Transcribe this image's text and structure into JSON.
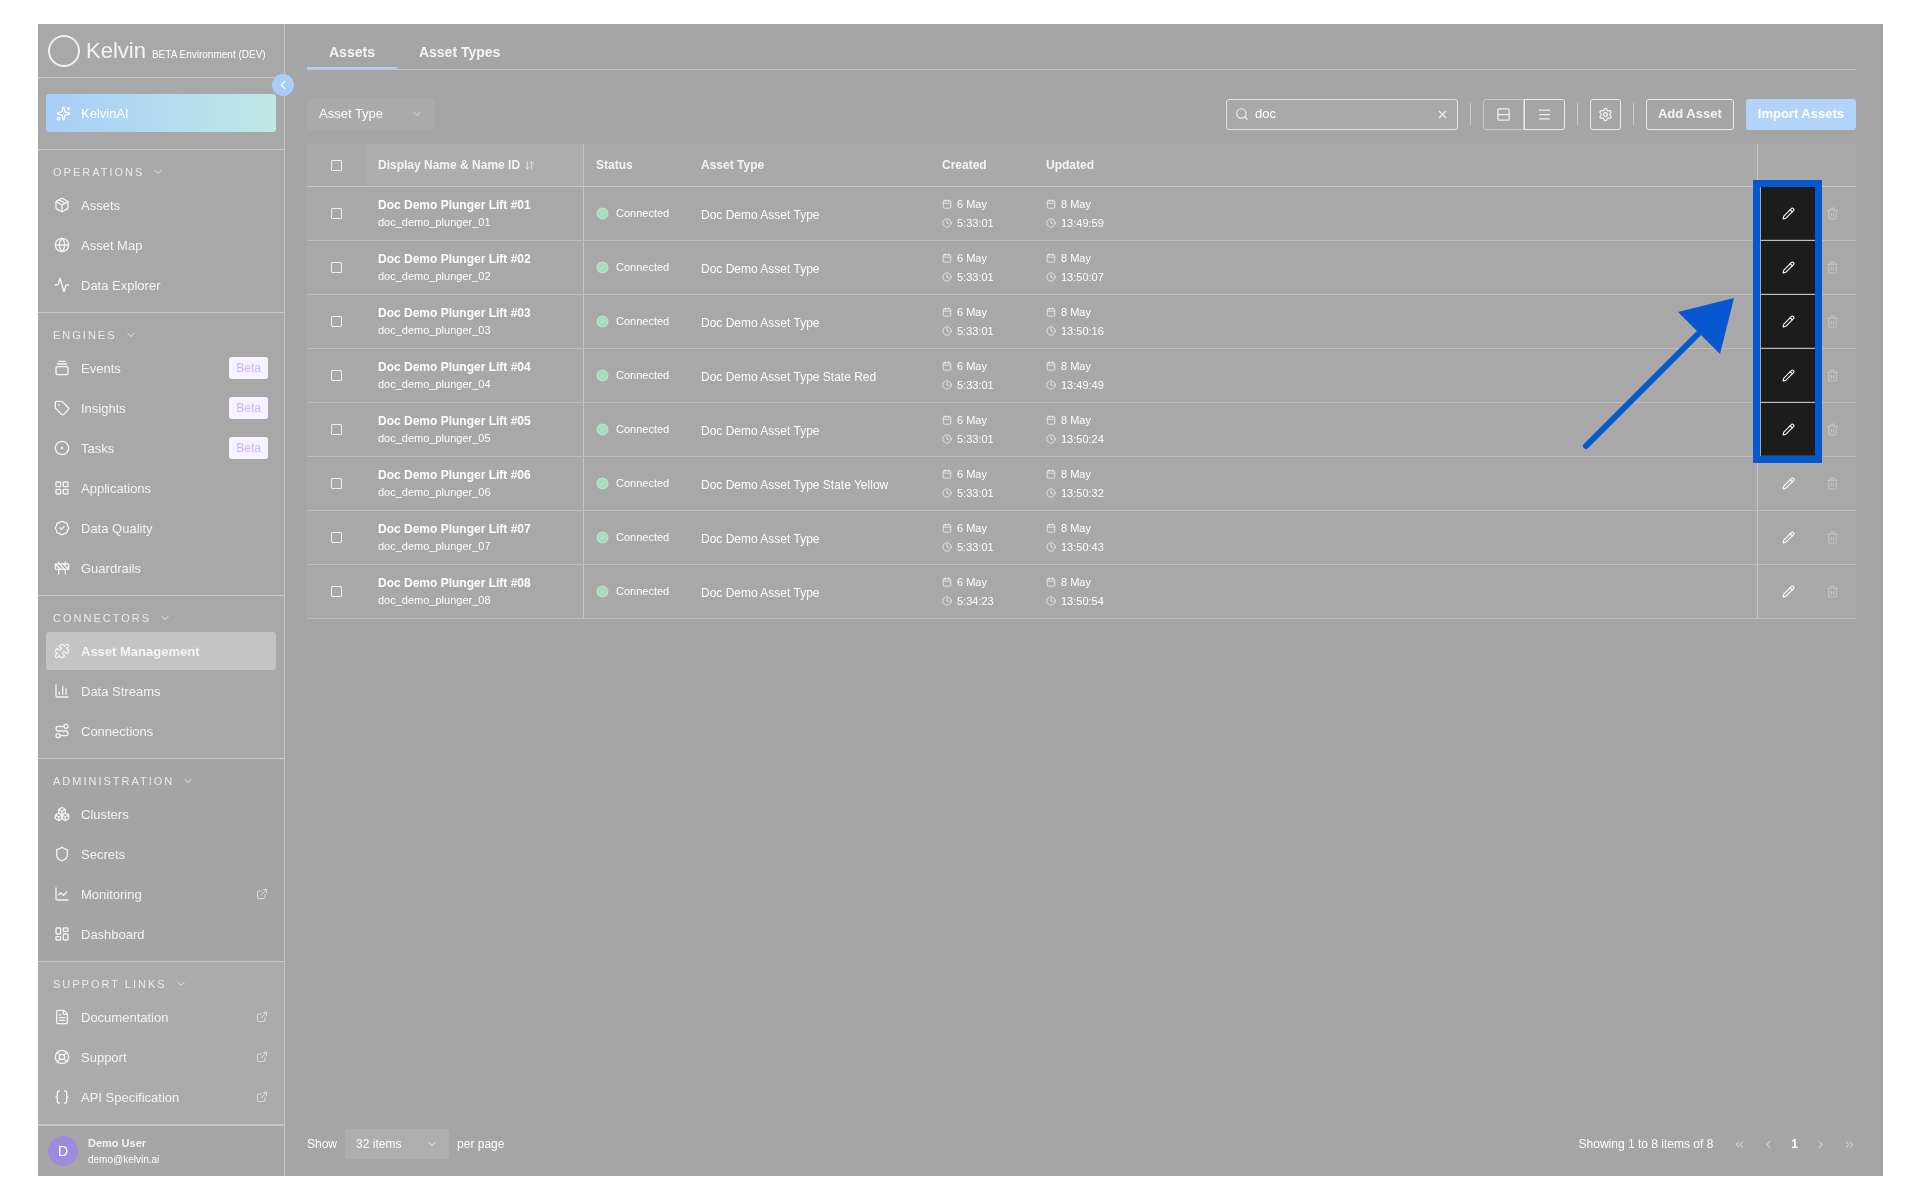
{
  "sidebar": {
    "logo": "Kelvin",
    "environment": "BETA Environment (DEV)",
    "ai_button": "KelvinAI",
    "sections": [
      {
        "title": "OPERATIONS",
        "items": [
          {
            "label": "Assets",
            "selected": false
          },
          {
            "label": "Asset Map",
            "selected": false
          },
          {
            "label": "Data Explorer",
            "selected": false
          }
        ]
      },
      {
        "title": "ENGINES",
        "items": [
          {
            "label": "Events",
            "badge": "Beta",
            "selected": false
          },
          {
            "label": "Insights",
            "badge": "Beta",
            "selected": false
          },
          {
            "label": "Tasks",
            "badge": "Beta",
            "selected": false
          },
          {
            "label": "Applications",
            "selected": false
          },
          {
            "label": "Data Quality",
            "selected": false
          },
          {
            "label": "Guardrails",
            "selected": false
          }
        ]
      },
      {
        "title": "CONNECTORS",
        "items": [
          {
            "label": "Asset Management",
            "selected": true
          },
          {
            "label": "Data Streams",
            "selected": false
          },
          {
            "label": "Connections",
            "selected": false
          }
        ]
      },
      {
        "title": "ADMINISTRATION",
        "items": [
          {
            "label": "Clusters",
            "selected": false
          },
          {
            "label": "Secrets",
            "selected": false
          },
          {
            "label": "Monitoring",
            "external": true,
            "selected": false
          },
          {
            "label": "Dashboard",
            "selected": false
          }
        ]
      },
      {
        "title": "SUPPORT LINKS",
        "items": [
          {
            "label": "Documentation",
            "external": true,
            "selected": false
          },
          {
            "label": "Support",
            "external": true,
            "selected": false
          },
          {
            "label": "API Specification",
            "external": true,
            "selected": false
          }
        ]
      }
    ],
    "user": {
      "initial": "D",
      "name": "Demo User",
      "email": "demo@kelvin.ai"
    }
  },
  "tabs": [
    {
      "label": "Assets",
      "selected": true
    },
    {
      "label": "Asset Types",
      "selected": false
    }
  ],
  "toolbar": {
    "filter": "Asset Type",
    "search": "doc",
    "add_button": "Add Asset",
    "import_button": "Import Assets"
  },
  "table": {
    "all_checked": false,
    "columns": [
      "Display Name & Name ID",
      "Status",
      "Asset Type",
      "Created",
      "Updated"
    ],
    "rows": [
      {
        "name": "Doc Demo Plunger Lift #01",
        "id": "doc_demo_plunger_01",
        "status": "Connected",
        "type": "Doc Demo Asset Type",
        "created_date": "6 May",
        "created_time": "5:33:01",
        "updated_date": "8 May",
        "updated_time": "13:49:59",
        "highlighted": true,
        "checked": false
      },
      {
        "name": "Doc Demo Plunger Lift #02",
        "id": "doc_demo_plunger_02",
        "status": "Connected",
        "type": "Doc Demo Asset Type",
        "created_date": "6 May",
        "created_time": "5:33:01",
        "updated_date": "8 May",
        "updated_time": "13:50:07",
        "highlighted": true,
        "checked": false
      },
      {
        "name": "Doc Demo Plunger Lift #03",
        "id": "doc_demo_plunger_03",
        "status": "Connected",
        "type": "Doc Demo Asset Type",
        "created_date": "6 May",
        "created_time": "5:33:01",
        "updated_date": "8 May",
        "updated_time": "13:50:16",
        "highlighted": true,
        "checked": false
      },
      {
        "name": "Doc Demo Plunger Lift #04",
        "id": "doc_demo_plunger_04",
        "status": "Connected",
        "type": "Doc Demo Asset Type State Red",
        "created_date": "6 May",
        "created_time": "5:33:01",
        "updated_date": "8 May",
        "updated_time": "13:49:49",
        "highlighted": true,
        "checked": false
      },
      {
        "name": "Doc Demo Plunger Lift #05",
        "id": "doc_demo_plunger_05",
        "status": "Connected",
        "type": "Doc Demo Asset Type",
        "created_date": "6 May",
        "created_time": "5:33:01",
        "updated_date": "8 May",
        "updated_time": "13:50:24",
        "highlighted": true,
        "checked": false
      },
      {
        "name": "Doc Demo Plunger Lift #06",
        "id": "doc_demo_plunger_06",
        "status": "Connected",
        "type": "Doc Demo Asset Type State Yellow",
        "created_date": "6 May",
        "created_time": "5:33:01",
        "updated_date": "8 May",
        "updated_time": "13:50:32",
        "highlighted": false,
        "checked": false
      },
      {
        "name": "Doc Demo Plunger Lift #07",
        "id": "doc_demo_plunger_07",
        "status": "Connected",
        "type": "Doc Demo Asset Type",
        "created_date": "6 May",
        "created_time": "5:33:01",
        "updated_date": "8 May",
        "updated_time": "13:50:43",
        "highlighted": false,
        "checked": false
      },
      {
        "name": "Doc Demo Plunger Lift #08",
        "id": "doc_demo_plunger_08",
        "status": "Connected",
        "type": "Doc Demo Asset Type",
        "created_date": "6 May",
        "created_time": "5:34:23",
        "updated_date": "8 May",
        "updated_time": "13:50:54",
        "highlighted": false,
        "checked": false
      }
    ]
  },
  "footer": {
    "show": "Show",
    "page_size": "32 items",
    "per_page": "per page",
    "summary": "Showing 1 to 8 items of 8",
    "page": "1"
  }
}
